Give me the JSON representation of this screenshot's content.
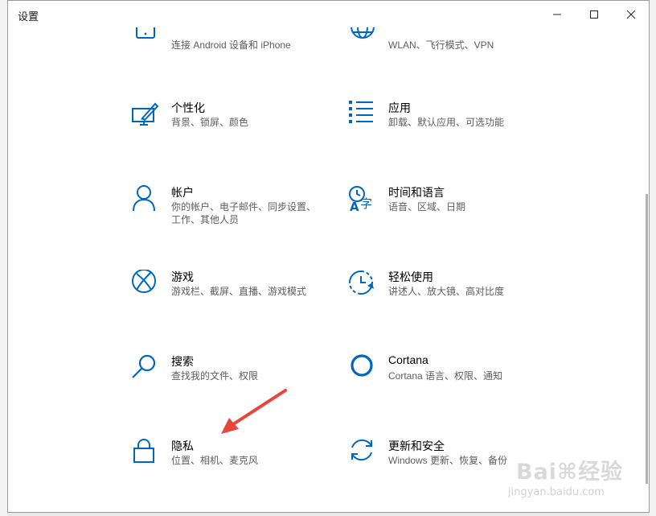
{
  "window": {
    "title": "设置",
    "minimize_icon": "minimize-icon",
    "maximize_icon": "maximize-icon",
    "close_icon": "close-icon"
  },
  "accent_color": "#0067c0",
  "tiles": [
    {
      "id": "phone",
      "name": "",
      "desc": "连接 Android 设备和 iPhone",
      "icon": "phone-icon"
    },
    {
      "id": "network",
      "name": "",
      "desc": "WLAN、飞行模式、VPN",
      "icon": "globe-icon"
    },
    {
      "id": "personalization",
      "name": "个性化",
      "desc": "背景、锁屏、颜色",
      "icon": "personalization-icon"
    },
    {
      "id": "apps",
      "name": "应用",
      "desc": "卸载、默认应用、可选功能",
      "icon": "apps-list-icon"
    },
    {
      "id": "accounts",
      "name": "帐户",
      "desc": "你的帐户、电子邮件、同步设置、工作、其他人员",
      "icon": "person-icon"
    },
    {
      "id": "time-language",
      "name": "时间和语言",
      "desc": "语音、区域、日期",
      "icon": "time-language-icon"
    },
    {
      "id": "gaming",
      "name": "游戏",
      "desc": "游戏栏、截屏、直播、游戏模式",
      "icon": "xbox-icon"
    },
    {
      "id": "ease-of-access",
      "name": "轻松使用",
      "desc": "讲述人、放大镜、高对比度",
      "icon": "ease-of-access-icon"
    },
    {
      "id": "search",
      "name": "搜索",
      "desc": "查找我的文件、权限",
      "icon": "search-icon"
    },
    {
      "id": "cortana",
      "name": "Cortana",
      "desc": "Cortana 语言、权限、通知",
      "icon": "cortana-icon"
    },
    {
      "id": "privacy",
      "name": "隐私",
      "desc": "位置、相机、麦克风",
      "icon": "lock-icon"
    },
    {
      "id": "update-security",
      "name": "更新和安全",
      "desc": "Windows 更新、恢复、备份",
      "icon": "sync-icon"
    }
  ],
  "watermark": {
    "logo": "Bai⌘经验",
    "url": "jingyan.baidu.com"
  }
}
